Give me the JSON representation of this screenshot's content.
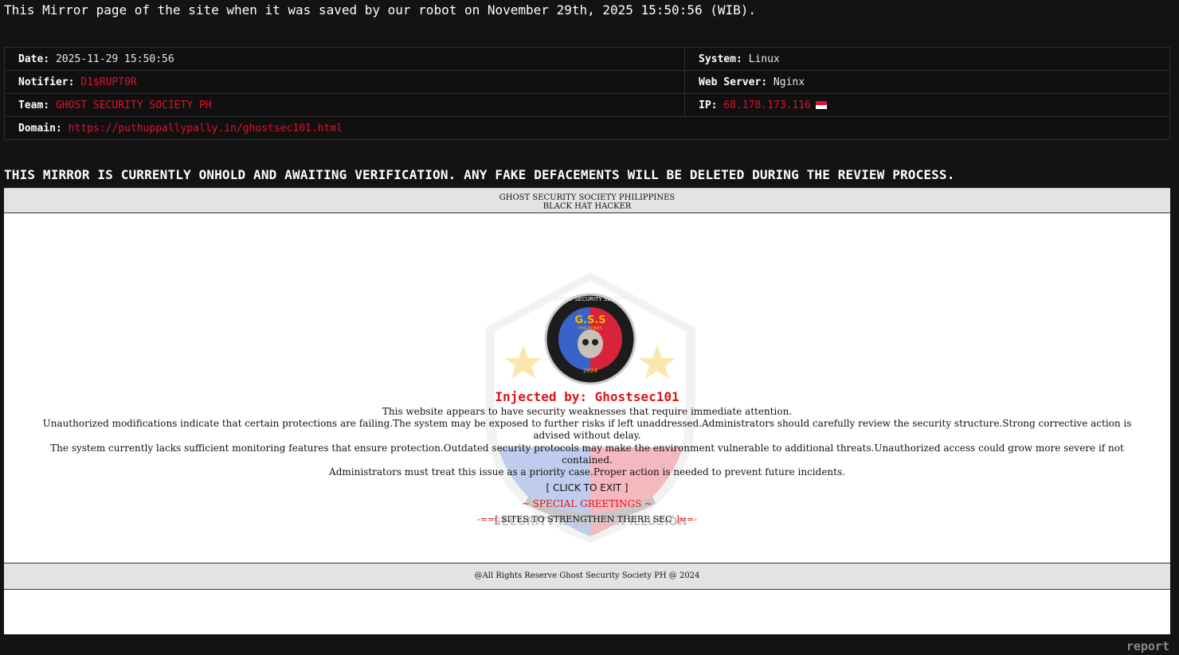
{
  "header": {
    "mirror_note": "This Mirror page of the site when it was saved by our robot on November 29th, 2025 15:50:56 (WIB)."
  },
  "info": {
    "date_label": "Date:",
    "date_value": "2025-11-29 15:50:56",
    "system_label": "System:",
    "system_value": "Linux",
    "notifier_label": "Notifier:",
    "notifier_value": "D1$RUPT0R",
    "webserver_label": "Web Server:",
    "webserver_value": "Nginx",
    "team_label": "Team:",
    "team_value": "GHOST SECURITY SOCIETY PH",
    "ip_label": "IP:",
    "ip_value": "68.178.173.116",
    "domain_label": "Domain:",
    "domain_value": "https://puthuppallypally.in/ghostsec101.html"
  },
  "onhold_notice": "THIS MIRROR IS CURRENTLY ONHOLD AND AWAITING VERIFICATION. ANY FAKE DEFACEMENTS WILL BE DELETED DURING THE REVIEW PROCESS.",
  "mirror": {
    "header_line1": "GHOST SECURITY SOCIETY PHILIPPINES",
    "header_line2": "BLACK HAT HACKER",
    "injected_by": "Injected by: Ghostsec101",
    "message_lines": [
      "This website appears to have security weaknesses that require immediate attention.",
      "Unauthorized modifications indicate that certain protections are failing.The system may be exposed to further risks if left unaddressed.Administrators should carefully review the security structure.Strong corrective action is advised without delay.",
      "The system currently lacks sufficient monitoring features that ensure protection.Outdated security protocols may make the environment vulnerable to additional threats.Unauthorized access could grow more severe if not contained.",
      "Administrators must treat this issue as a priority case.Proper action is needed to prevent future incidents."
    ],
    "exit_label": "[ CLICK TO EXIT ]",
    "greetings": "~ SPECIAL GREETINGS ~",
    "marquee_left": "-==[",
    "marquee_text": "SITES TO STRENGTHEN THERE SECURITY",
    "marquee_right": "]==-",
    "footer": "@All Rights Reserve Ghost Security Society PH @ 2024",
    "logo_top_text": "GHOST SECURITY SOCIETY",
    "logo_center_text": "G.S.S",
    "logo_sub_text": "PHILIPPINES",
    "logo_bottom_text": "SECURITY IS JUST AN ILLUSION",
    "logo_year": "2024"
  },
  "report_label": "report",
  "colors": {
    "background": "#131313",
    "accent_red": "#e0102e",
    "flag_red": "#e0102e",
    "flag_white": "#ffffff"
  }
}
